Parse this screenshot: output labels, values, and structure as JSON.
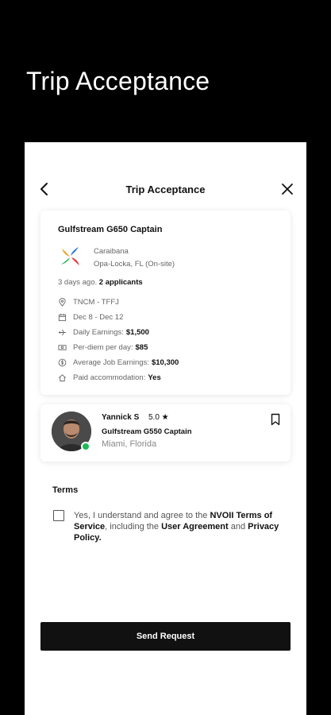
{
  "page": {
    "hero_title": "Trip Acceptance"
  },
  "nav": {
    "title": "Trip Acceptance"
  },
  "job": {
    "title": "Gulfstream G650 Captain",
    "company": "Caraibana",
    "location": "Opa-Locka, FL (On-site)",
    "posted": "3 days ago.",
    "applicants": "2 applicants",
    "route": "TNCM - TFFJ",
    "dates": "Dec 8 - Dec 12",
    "daily_earnings_label": "Daily Earnings:",
    "daily_earnings_value": "$1,500",
    "per_diem_label": "Per-diem per day:",
    "per_diem_value": "$85",
    "avg_earnings_label": "Average Job Earnings:",
    "avg_earnings_value": "$10,300",
    "accommodation_label": "Paid accommodation:",
    "accommodation_value": "Yes"
  },
  "pilot": {
    "name": "Yannick S",
    "rating": "5.0 ★",
    "role": "Gulfstream G550 Captain",
    "location": "Miami, Florida",
    "status_color": "#1db954"
  },
  "terms": {
    "heading": "Terms",
    "text_1": "Yes, I understand and agree to the ",
    "link_terms": "NVOII Terms of Service",
    "text_2": ", including the ",
    "link_agreement": "User Agreement",
    "text_3": " and ",
    "link_privacy": "Privacy Policy.",
    "checked": false
  },
  "actions": {
    "send_label": "Send Request"
  },
  "icons": {
    "back": "chevron-left-icon",
    "close": "close-icon",
    "bookmark": "bookmark-icon",
    "route": "location-pin-icon",
    "dates": "calendar-icon",
    "daily": "plane-icon",
    "per_diem": "cash-icon",
    "average": "dollar-circle-icon",
    "accommodation": "home-icon"
  }
}
